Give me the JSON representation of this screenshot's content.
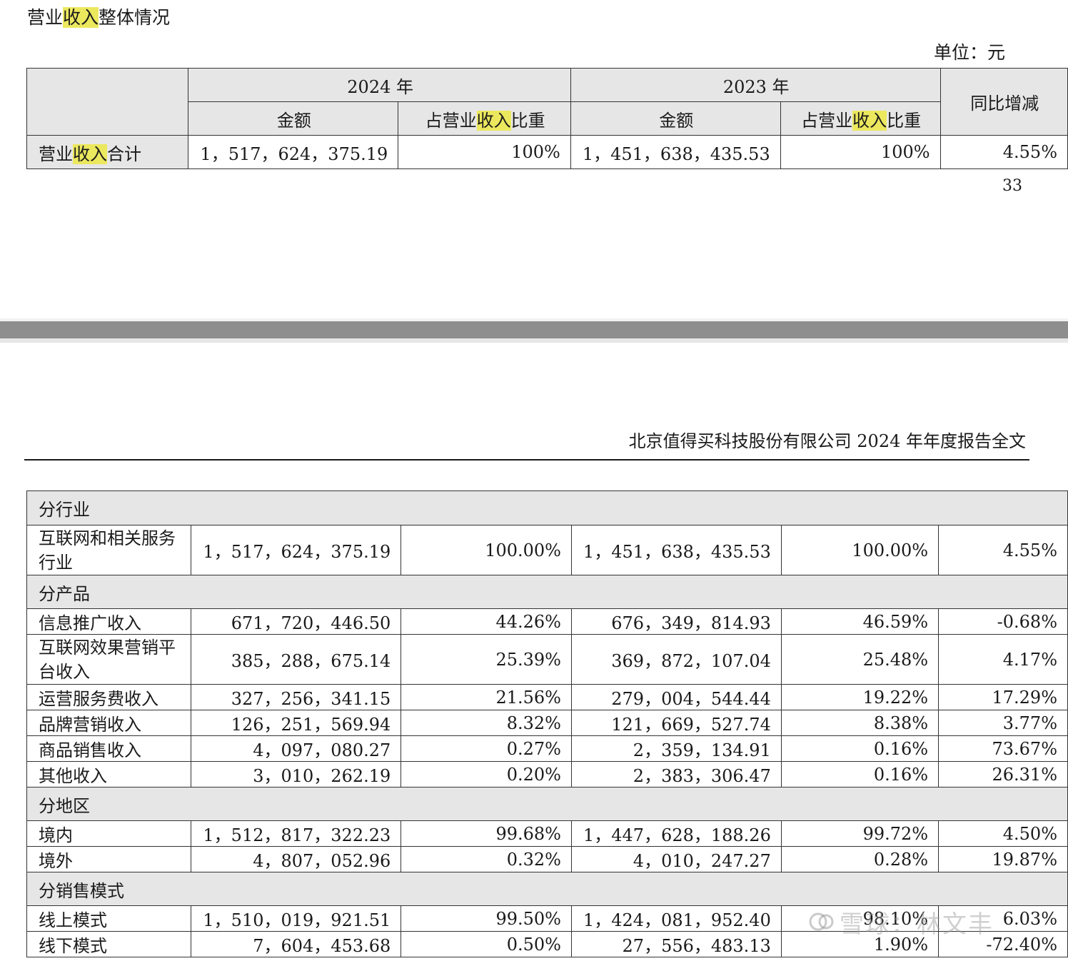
{
  "section": {
    "title_pre": "营业",
    "title_hl": "收入",
    "title_post": "整体情况"
  },
  "unit": "单位：元",
  "top_table": {
    "year_2024": "2024 年",
    "year_2023": "2023 年",
    "yoy_header": "同比增减",
    "amount_header": "金额",
    "share_header_pre": "占营业",
    "share_header_hl": "收入",
    "share_header_post": "比重",
    "total_label_pre": "营业",
    "total_label_hl": "收入",
    "total_label_post": "合计",
    "total_2024_amount": "1，517，624，375.19",
    "total_2024_share": "100%",
    "total_2023_amount": "1，451，638，435.53",
    "total_2023_share": "100%",
    "total_yoy": "4.55%"
  },
  "page_number": "33",
  "report_header": "北京值得买科技股份有限公司 2024 年年度报告全文",
  "bottom_table": {
    "sec_industry": "分行业",
    "industry_rows": [
      {
        "label": "互联网和相关服务行业",
        "a2024": "1，517，624，375.19",
        "s2024": "100.00%",
        "a2023": "1，451，638，435.53",
        "s2023": "100.00%",
        "yoy": "4.55%"
      }
    ],
    "sec_product": "分产品",
    "product_rows": [
      {
        "label": "信息推广收入",
        "a2024": "671，720，446.50",
        "s2024": "44.26%",
        "a2023": "676，349，814.93",
        "s2023": "46.59%",
        "yoy": "-0.68%"
      },
      {
        "label": "互联网效果营销平台收入",
        "a2024": "385，288，675.14",
        "s2024": "25.39%",
        "a2023": "369，872，107.04",
        "s2023": "25.48%",
        "yoy": "4.17%"
      },
      {
        "label": "运营服务费收入",
        "a2024": "327，256，341.15",
        "s2024": "21.56%",
        "a2023": "279，004，544.44",
        "s2023": "19.22%",
        "yoy": "17.29%"
      },
      {
        "label": "品牌营销收入",
        "a2024": "126，251，569.94",
        "s2024": "8.32%",
        "a2023": "121，669，527.74",
        "s2023": "8.38%",
        "yoy": "3.77%"
      },
      {
        "label": "商品销售收入",
        "a2024": "4，097，080.27",
        "s2024": "0.27%",
        "a2023": "2，359，134.91",
        "s2023": "0.16%",
        "yoy": "73.67%"
      },
      {
        "label": "其他收入",
        "a2024": "3，010，262.19",
        "s2024": "0.20%",
        "a2023": "2，383，306.47",
        "s2023": "0.16%",
        "yoy": "26.31%"
      }
    ],
    "sec_region": "分地区",
    "region_rows": [
      {
        "label": "境内",
        "a2024": "1，512，817，322.23",
        "s2024": "99.68%",
        "a2023": "1，447，628，188.26",
        "s2023": "99.72%",
        "yoy": "4.50%"
      },
      {
        "label": "境外",
        "a2024": "4，807，052.96",
        "s2024": "0.32%",
        "a2023": "4，010，247.27",
        "s2023": "0.28%",
        "yoy": "19.87%"
      }
    ],
    "sec_sales": "分销售模式",
    "sales_rows": [
      {
        "label": "线上模式",
        "a2024": "1，510，019，921.51",
        "s2024": "99.50%",
        "a2023": "1，424，081，952.40",
        "s2023": "98.10%",
        "yoy": "6.03%"
      },
      {
        "label": "线下模式",
        "a2024": "7，604，453.68",
        "s2024": "0.50%",
        "a2023": "27，556，483.13",
        "s2023": "1.90%",
        "yoy": "-72.40%"
      }
    ]
  },
  "watermark": {
    "icon": "snowball-icon",
    "text": "雪球：林文丰"
  }
}
